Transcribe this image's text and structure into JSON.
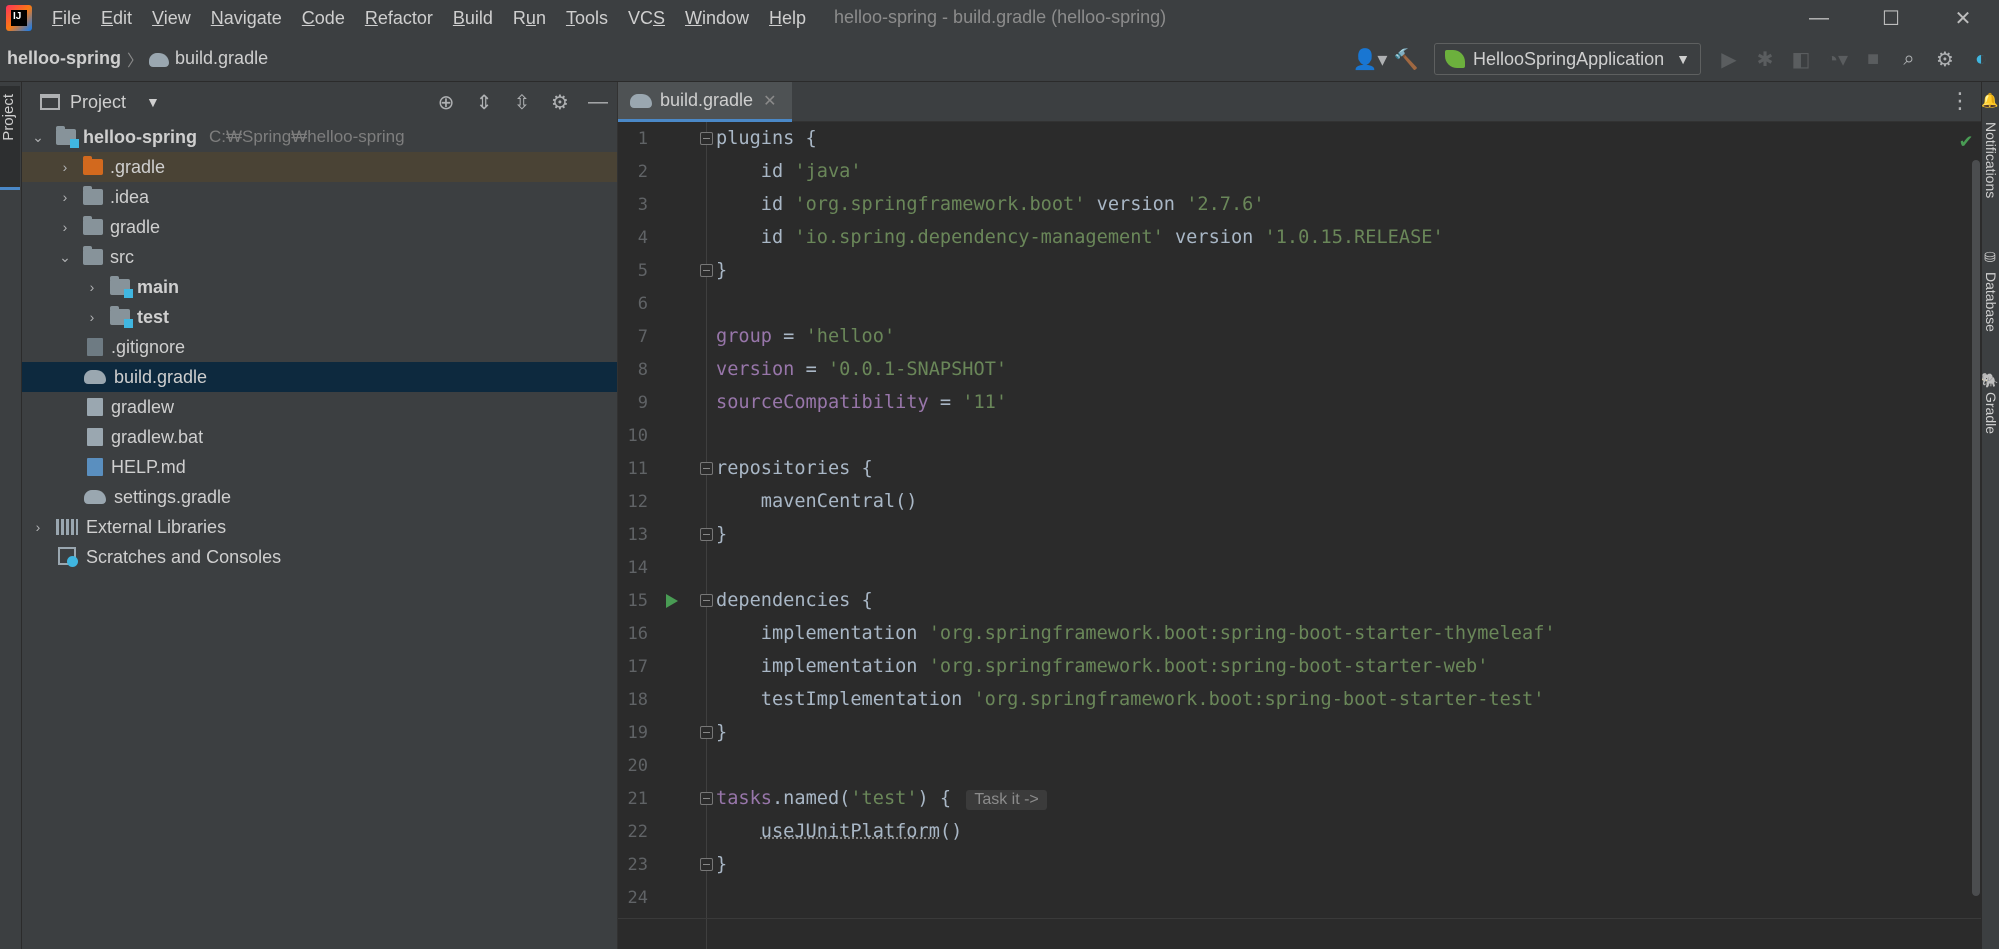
{
  "window": {
    "title": "helloo-spring - build.gradle (helloo-spring)",
    "menu": [
      {
        "label": "File",
        "key": "F"
      },
      {
        "label": "Edit",
        "key": "E"
      },
      {
        "label": "View",
        "key": "V"
      },
      {
        "label": "Navigate",
        "key": "N"
      },
      {
        "label": "Code",
        "key": "C"
      },
      {
        "label": "Refactor",
        "key": "R"
      },
      {
        "label": "Build",
        "key": "B"
      },
      {
        "label": "Run",
        "key": "u"
      },
      {
        "label": "Tools",
        "key": "T"
      },
      {
        "label": "VCS",
        "key": "S"
      },
      {
        "label": "Window",
        "key": "W"
      },
      {
        "label": "Help",
        "key": "H"
      }
    ],
    "controls": {
      "minimize": "—",
      "maximize": "☐",
      "close": "✕"
    }
  },
  "navbar": {
    "project": "helloo-spring",
    "file": "build.gradle",
    "run_config": "HellooSpringApplication"
  },
  "left_strip": {
    "tab_label": "Project"
  },
  "project_panel": {
    "title": "Project",
    "tree": [
      {
        "label": "helloo-spring",
        "path": "C:₩Spring₩helloo-spring"
      },
      {
        "label": ".gradle"
      },
      {
        "label": ".idea"
      },
      {
        "label": "gradle"
      },
      {
        "label": "src"
      },
      {
        "label": "main"
      },
      {
        "label": "test"
      },
      {
        "label": ".gitignore"
      },
      {
        "label": "build.gradle"
      },
      {
        "label": "gradlew"
      },
      {
        "label": "gradlew.bat"
      },
      {
        "label": "HELP.md"
      },
      {
        "label": "settings.gradle"
      },
      {
        "label": "External Libraries"
      },
      {
        "label": "Scratches and Consoles"
      }
    ]
  },
  "editor": {
    "tab_label": "build.gradle",
    "inlay_hint": "Task it ->",
    "line_numbers": [
      "1",
      "2",
      "3",
      "4",
      "5",
      "6",
      "7",
      "8",
      "9",
      "10",
      "11",
      "12",
      "13",
      "14",
      "15",
      "16",
      "17",
      "18",
      "19",
      "20",
      "21",
      "22",
      "23",
      "24"
    ]
  },
  "right_strip": {
    "notifications": "Notifications",
    "database": "Database",
    "gradle": "Gradle"
  },
  "colors": {
    "string": "#6a8759",
    "property": "#9876aa",
    "code": "#a9b7c6",
    "selection": "#0d293e",
    "run_gutter": "#499c54"
  }
}
